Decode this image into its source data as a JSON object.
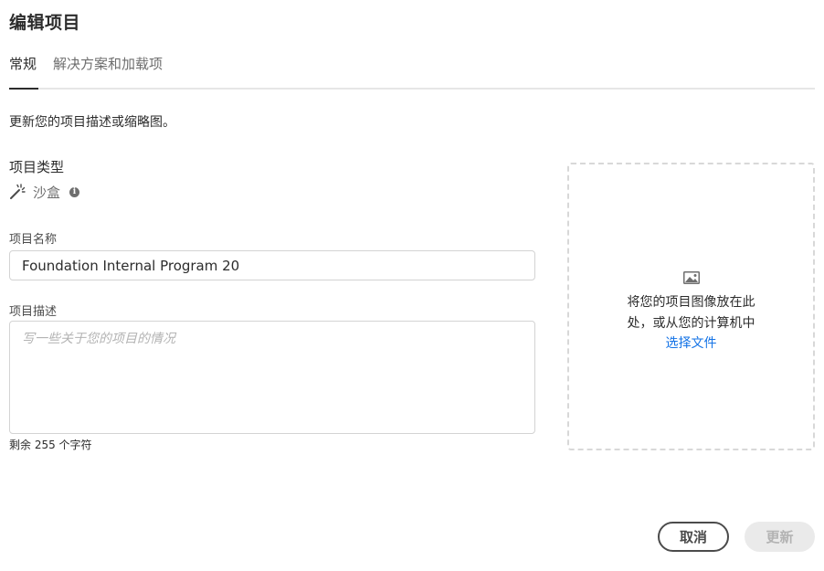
{
  "dialog": {
    "title": "编辑项目"
  },
  "tabs": [
    {
      "label": "常规",
      "active": true
    },
    {
      "label": "解决方案和加载项",
      "active": false
    }
  ],
  "intro": "更新您的项目描述或缩略图。",
  "project_type": {
    "label": "项目类型",
    "value": "沙盒",
    "icon": "magic-wand-icon",
    "info_icon": "info-icon"
  },
  "project_name": {
    "label": "项目名称",
    "value": "Foundation Internal Program 20"
  },
  "project_description": {
    "label": "项目描述",
    "placeholder": "写一些关于您的项目的情况",
    "value": "",
    "remaining": "剩余 255 个字符"
  },
  "thumbnail": {
    "icon": "image-icon",
    "prompt": "将您的项目图像放在此处，或从您的计算机中",
    "link": "选择文件"
  },
  "footer": {
    "cancel_label": "取消",
    "update_label": "更新"
  },
  "colors": {
    "link": "#1473e6",
    "text": "#2c2c2c",
    "disabled_bg": "#eaeaea",
    "disabled_text": "#b3b3b3"
  }
}
